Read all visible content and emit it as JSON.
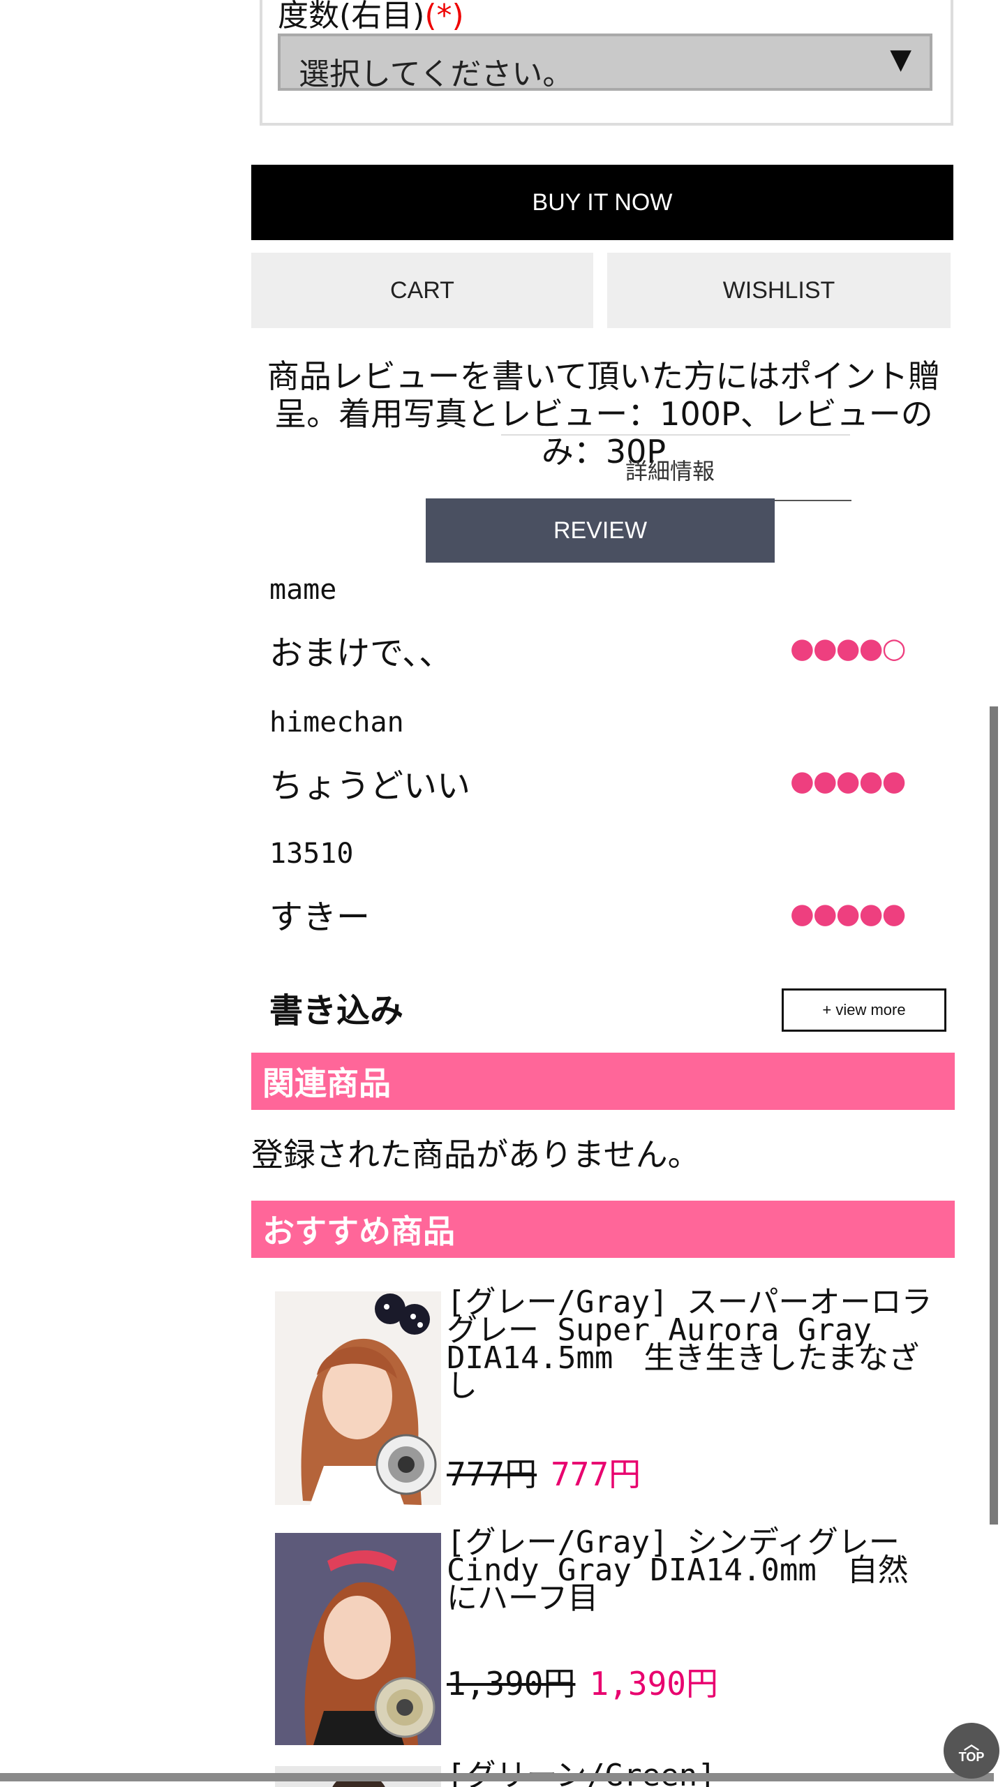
{
  "option": {
    "label": "度数(右目)",
    "required_mark": "(*)",
    "select_value": "選択してください。",
    "arrow": "▼"
  },
  "buttons": {
    "buy_now": "BUY IT NOW",
    "cart": "CART",
    "wishlist": "WISHLIST",
    "review": "REVIEW",
    "view_more": "+ view more",
    "top": "TOP"
  },
  "review_notice": {
    "text": "商品レビューを書いて頂いた方にはポイント贈呈。着用写真とレビュー：100P、レビューのみ：30P",
    "detail_link": "詳細情報"
  },
  "reviews": [
    {
      "user": "mame",
      "comment": "おまけで、、",
      "stars": "●●●●○",
      "rating": 4
    },
    {
      "user": "himechan",
      "comment": "ちょうどいい",
      "stars": "●●●●●",
      "rating": 5
    },
    {
      "user": "13510",
      "comment": "すきー",
      "stars": "●●●●●",
      "rating": 5
    }
  ],
  "write_label": "書き込み",
  "related": {
    "title": "関連商品",
    "empty": "登録された商品がありません。"
  },
  "recommended": {
    "title": "おすすめ商品",
    "products": [
      {
        "name": "[グレー/Gray] スーパーオーロラグレー Super Aurora Gray DIA14.5mm　生き生きしたまなざし",
        "old_price": "777円",
        "price": "777円"
      },
      {
        "name": "[グレー/Gray] シンディグレー Cindy Gray DIA14.0mm　自然にハーフ目",
        "old_price": "1,390円",
        "price": "1,390円"
      },
      {
        "name": "[グリーン/Green]",
        "old_price": "",
        "price": ""
      }
    ]
  },
  "colors": {
    "accent_pink": "#ff6699",
    "star_pink": "#ee3f7f",
    "price_pink": "#e8006e",
    "review_button": "#4a5061"
  }
}
